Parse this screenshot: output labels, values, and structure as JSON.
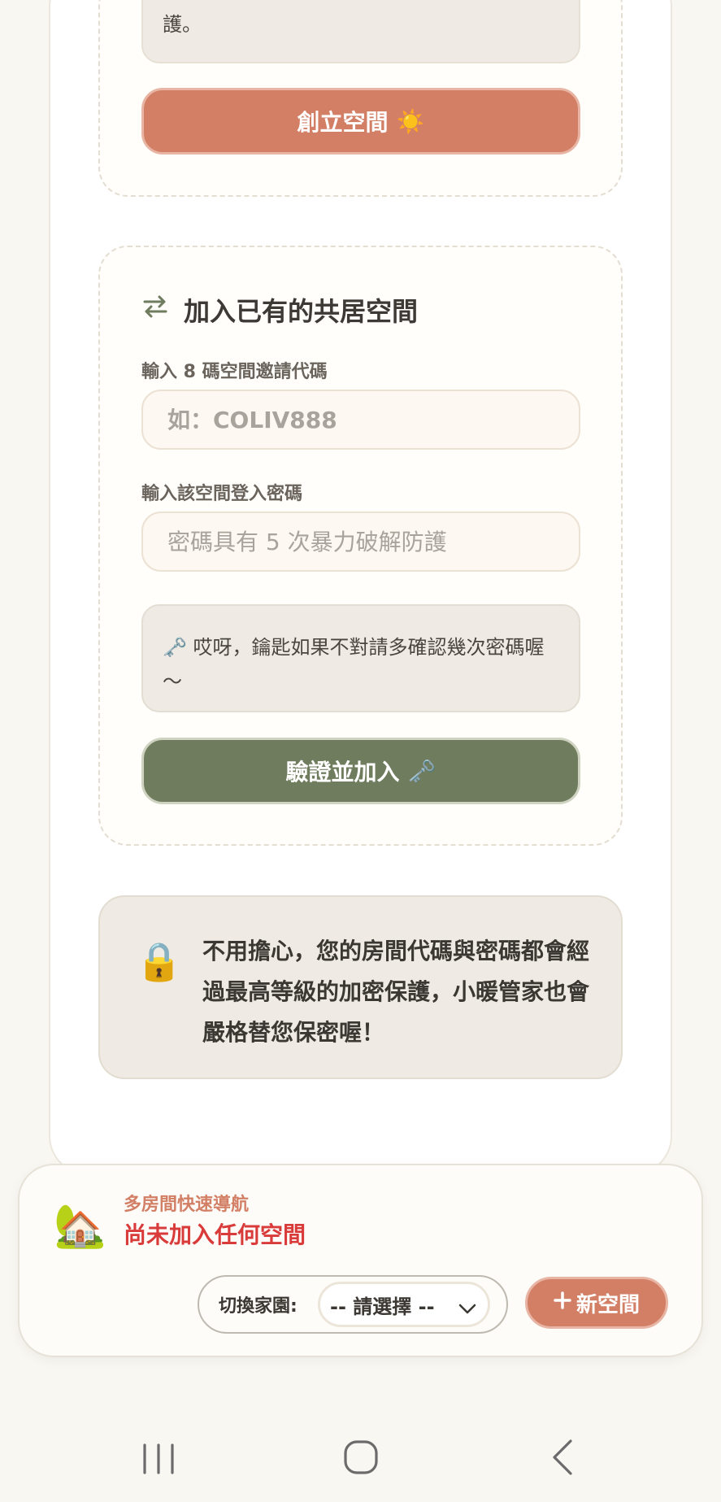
{
  "create_section": {
    "notice_text": "護。",
    "create_button": {
      "label": "創立空間",
      "emoji": "☀️"
    }
  },
  "join_section": {
    "icon": "swap-arrows-icon",
    "title": "加入已有的共居空間",
    "code_label": "輸入 8 碼空間邀請代碼",
    "code_placeholder": "如：COLIV888",
    "password_label": "輸入該空間登入密碼",
    "password_placeholder": "密碼具有 5 次暴力破解防護",
    "hint_emoji": "🗝️",
    "hint_text": "哎呀，鑰匙如果不對請多確認幾次密碼喔～",
    "verify_button": {
      "label": "驗證並加入",
      "emoji": "🗝️"
    }
  },
  "security_notice": {
    "emoji": "🔒",
    "text": "不用擔心，您的房間代碼與密碼都會經過最高等級的加密保護，小暖管家也會嚴格替您保密喔！"
  },
  "room_nav": {
    "house_emoji": "🏡",
    "subtitle": "多房間快速導航",
    "status": "尚未加入任何空間",
    "switch_label": "切換家園:",
    "select_value": "-- 請選擇 --",
    "new_space_button": "新空間",
    "new_space_icon": "plus-icon"
  },
  "colors": {
    "accent_terracotta": "#d27f66",
    "accent_olive": "#6f7c5e",
    "warning_red": "#d93a3a",
    "background": "#f9f7f2"
  }
}
